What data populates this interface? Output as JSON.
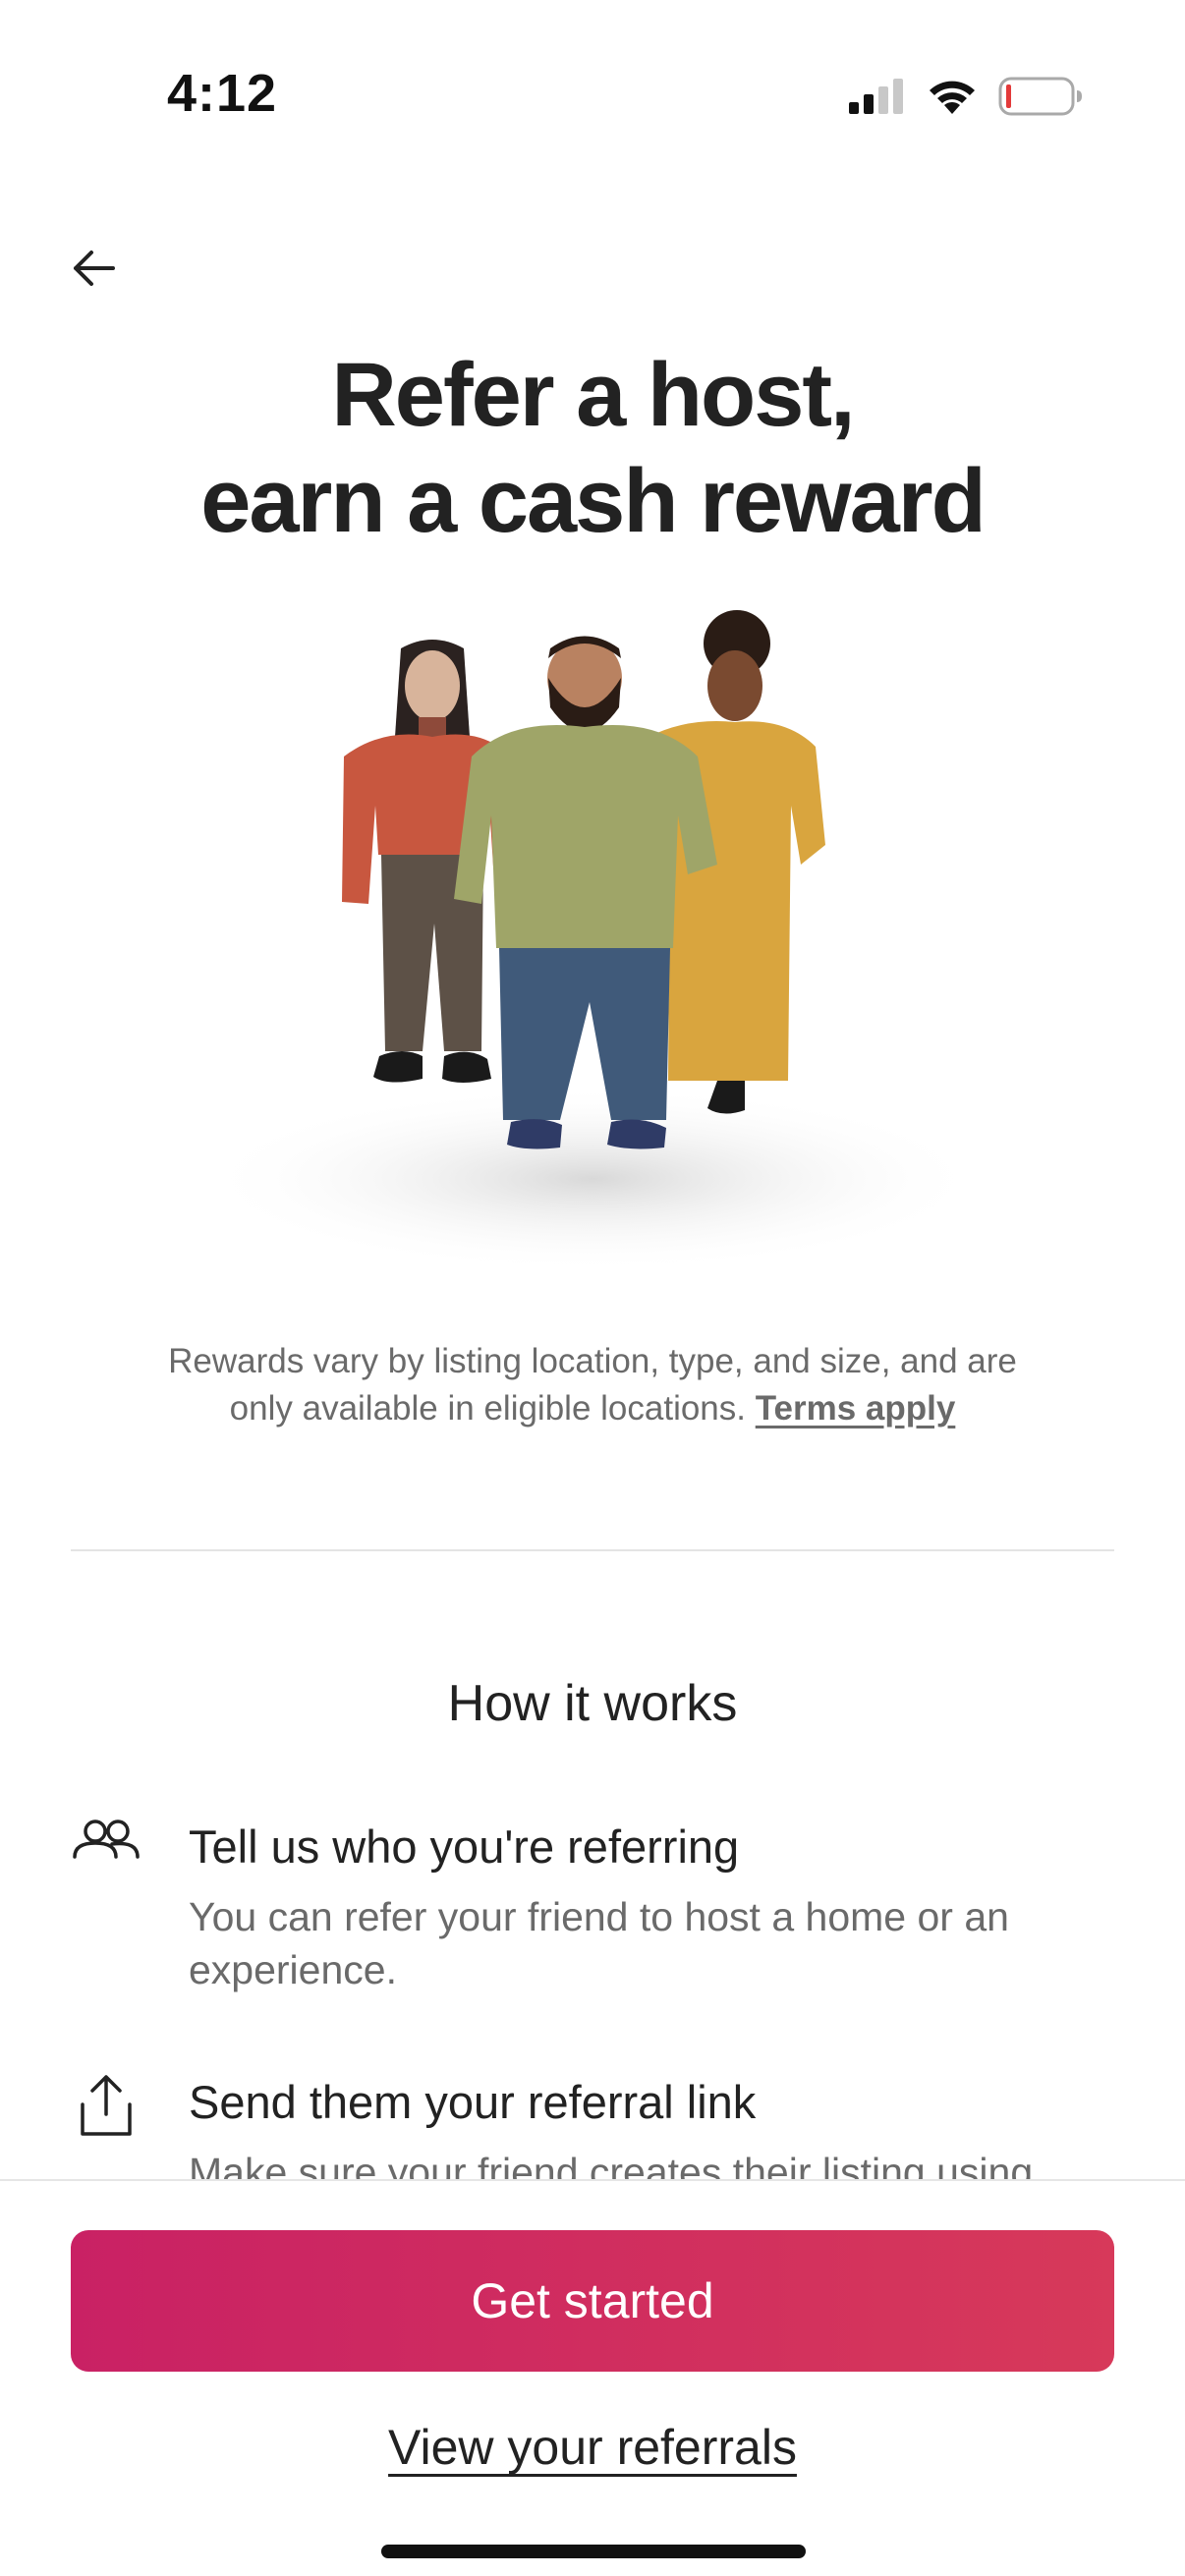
{
  "status_bar": {
    "time": "4:12",
    "icons": [
      "cellular-signal-icon",
      "wifi-icon",
      "battery-low-icon"
    ],
    "battery_color": "#e33a3a"
  },
  "nav": {
    "back_icon": "arrow-left-icon"
  },
  "hero": {
    "title_line1": "Refer a host,",
    "title_line2": "earn a cash reward",
    "illustration": "three-people-illustration"
  },
  "disclaimer": {
    "text_line1": "Rewards vary by listing location, type, and size, and are",
    "text_line2": "only available in eligible locations.",
    "terms_link": "Terms apply"
  },
  "how_it_works": {
    "title": "How it works",
    "steps": [
      {
        "icon": "people-icon",
        "title": "Tell us who you're referring",
        "description": "You can refer your friend to host a home or an experience."
      },
      {
        "icon": "share-upload-icon",
        "title": "Send them your referral link",
        "description": "Make sure your friend creates their listing using"
      }
    ]
  },
  "footer": {
    "primary_button": "Get started",
    "secondary_link": "View your referrals"
  },
  "colors": {
    "brand_gradient_start": "#c92164",
    "brand_gradient_end": "#d7395a",
    "text_primary": "#222222",
    "text_secondary": "#6a6a6a"
  }
}
